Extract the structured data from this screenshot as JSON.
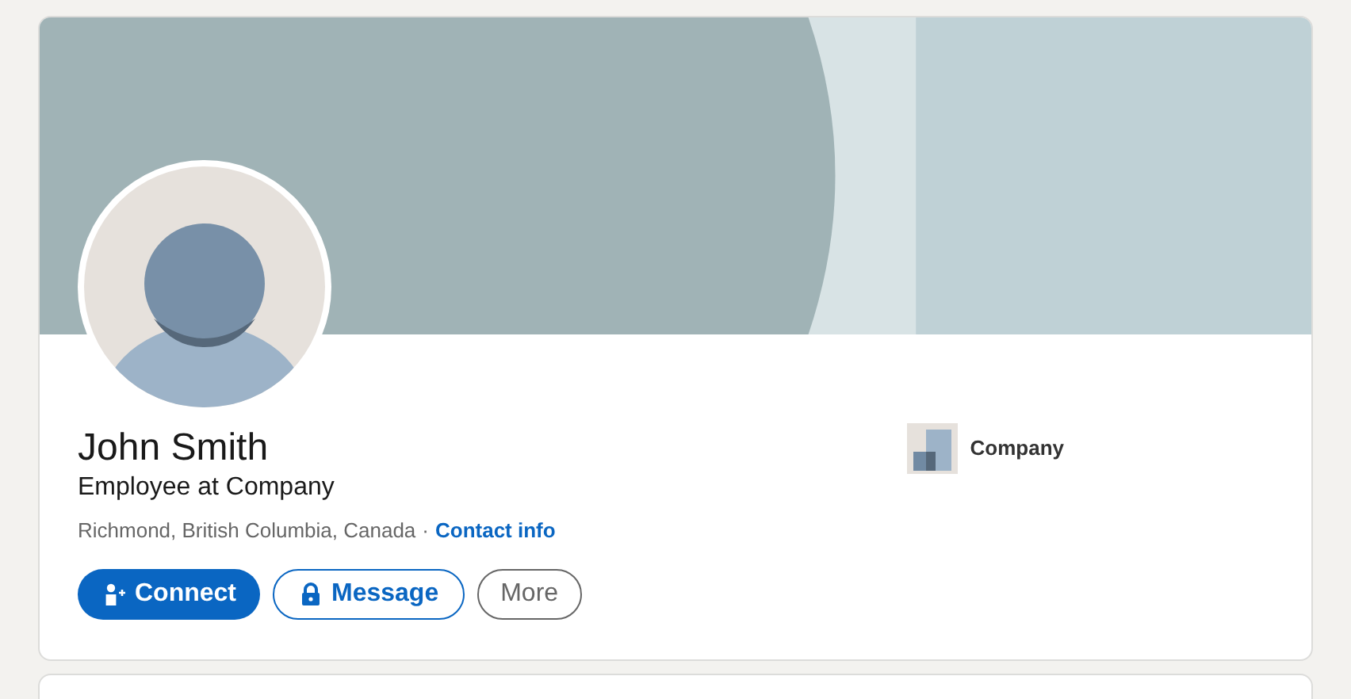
{
  "profile": {
    "name": "John Smith",
    "headline": "Employee at Company",
    "location": "Richmond, British Columbia, Canada",
    "separator": "·",
    "contact_link": "Contact info"
  },
  "actions": [
    {
      "label": "Connect",
      "kind": "primary"
    },
    {
      "label": "Message",
      "kind": "secondary"
    },
    {
      "label": "More",
      "kind": "tertiary"
    }
  ],
  "company": {
    "name": "Company"
  }
}
